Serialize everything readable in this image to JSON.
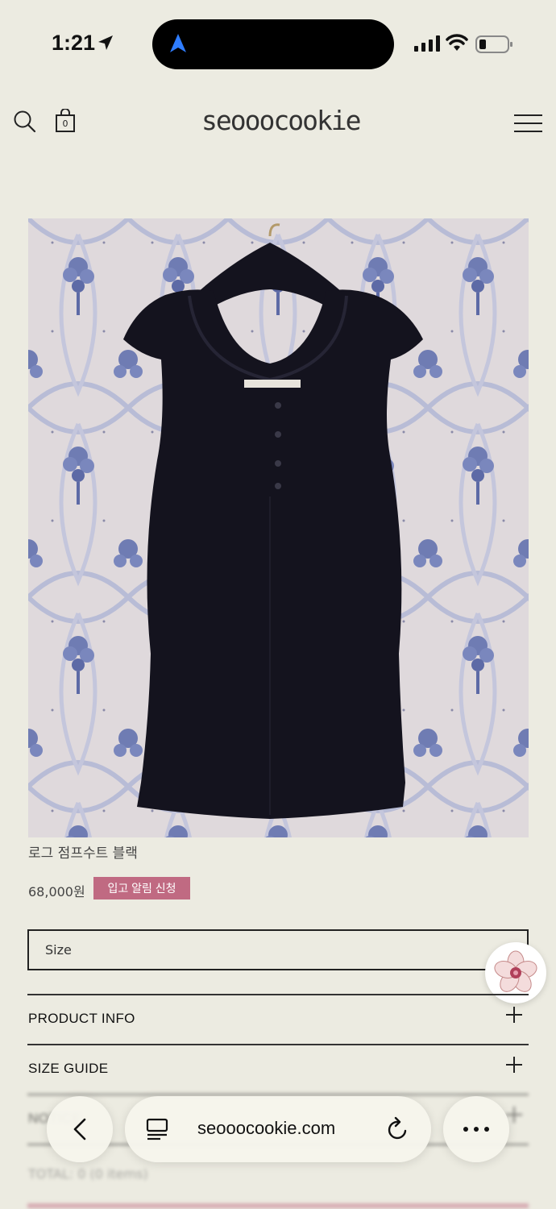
{
  "status_bar": {
    "time": "1:21",
    "icons": [
      "location-arrow-icon",
      "navigation-icon",
      "signal-icon",
      "wifi-icon",
      "battery-icon"
    ]
  },
  "header": {
    "logo": "seooocookie",
    "cart_count": "0",
    "icons": [
      "search-icon",
      "shopping-bag-icon",
      "hamburger-menu-icon"
    ]
  },
  "product": {
    "name": "로그 점프수트 블랙",
    "price": "68,000원",
    "restock_label": "입고 알림 신청",
    "size_placeholder": "Size"
  },
  "accordions": [
    {
      "label": "PRODUCT INFO"
    },
    {
      "label": "SIZE GUIDE"
    },
    {
      "label": "NOTICE"
    }
  ],
  "total": "TOTAL: 0 (0 items)",
  "browser": {
    "url": "seooocookie.com",
    "icons": [
      "back-chevron-icon",
      "reader-icon",
      "reload-icon",
      "more-icon"
    ]
  },
  "colors": {
    "background": "#ecebe1",
    "accent": "#c06a82",
    "garment": "#14131e"
  }
}
